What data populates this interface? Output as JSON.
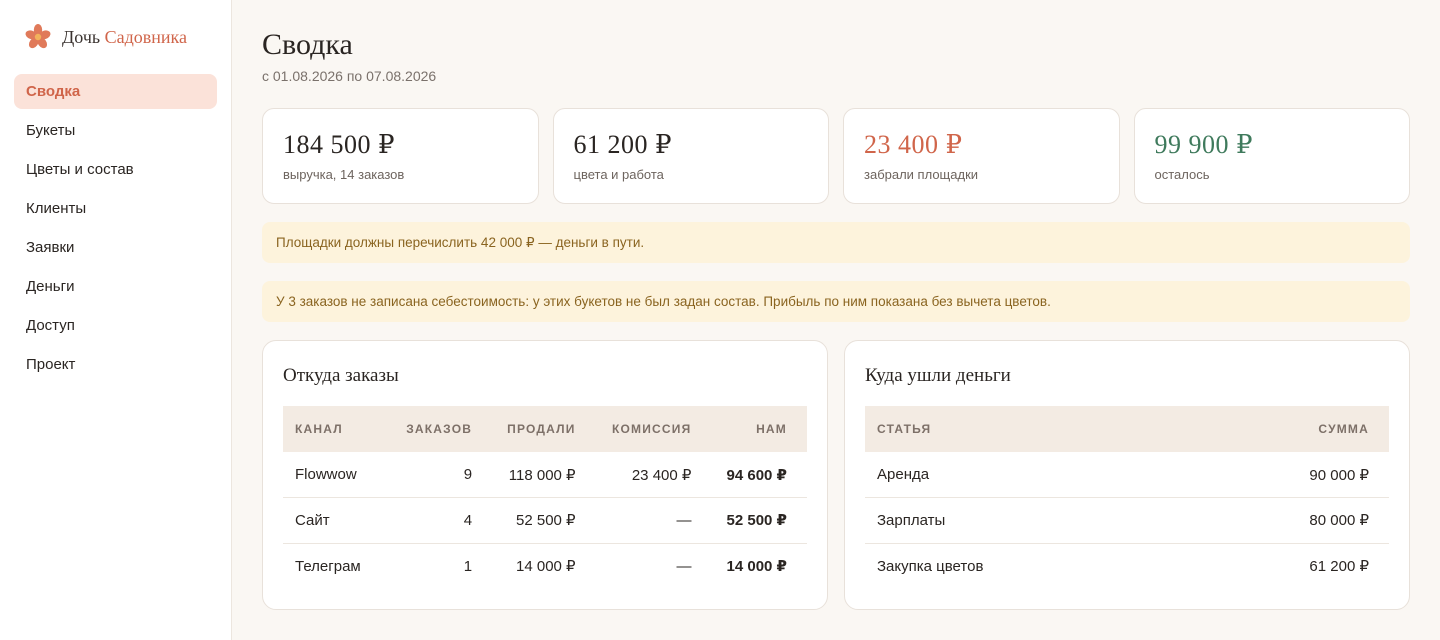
{
  "brand": {
    "name_part1": "Дочь",
    "name_part2": "Садовника",
    "accent": "#d0654a"
  },
  "sidebar": {
    "items": [
      {
        "label": "Сводка",
        "active": true
      },
      {
        "label": "Букеты"
      },
      {
        "label": "Цветы и состав"
      },
      {
        "label": "Клиенты"
      },
      {
        "label": "Заявки"
      },
      {
        "label": "Деньги"
      },
      {
        "label": "Доступ"
      },
      {
        "label": "Проект"
      }
    ]
  },
  "header": {
    "title": "Сводка",
    "period": "с 01.08.2026 по 07.08.2026"
  },
  "stats": [
    {
      "value": "184 500 ₽",
      "label": "выручка, 14 заказов"
    },
    {
      "value": "61 200 ₽",
      "label": "цвета и работа"
    },
    {
      "value": "23 400 ₽",
      "label": "забрали площадки",
      "color": "#d0654a"
    },
    {
      "value": "99 900 ₽",
      "label": "осталось",
      "color": "#3f7a5c"
    }
  ],
  "notices": [
    "Площадки должны перечислить 42 000 ₽ — деньги в пути.",
    "У 3 заказов не записана себестоимость: у этих букетов не был задан состав. Прибыль по ним показана без вычета цветов."
  ],
  "orders_panel": {
    "title": "Откуда заказы",
    "columns": [
      "Канал",
      "Заказов",
      "Продали",
      "Комиссия",
      "Нам"
    ],
    "rows": [
      [
        "Flowwow",
        "9",
        "118 000 ₽",
        "23 400 ₽",
        "94 600 ₽"
      ],
      [
        "Сайт",
        "4",
        "52 500 ₽",
        "—",
        "52 500 ₽"
      ],
      [
        "Телеграм",
        "1",
        "14 000 ₽",
        "—",
        "14 000 ₽"
      ]
    ]
  },
  "money_panel": {
    "title": "Куда ушли деньги",
    "columns": [
      "Статья",
      "Сумма"
    ],
    "rows": [
      [
        "Аренда",
        "90 000 ₽"
      ],
      [
        "Зарплаты",
        "80 000 ₽"
      ],
      [
        "Закупка цветов",
        "61 200 ₽"
      ]
    ]
  },
  "icons": {
    "logo": "flower-icon"
  }
}
